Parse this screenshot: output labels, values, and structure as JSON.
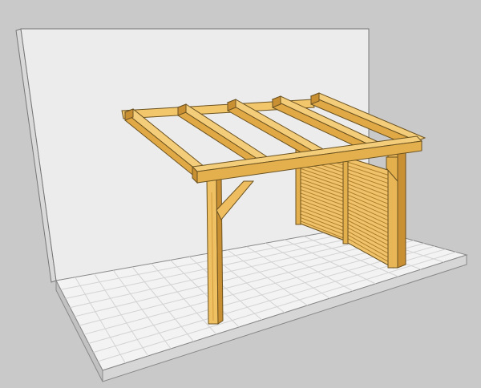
{
  "scene": {
    "subject": "wooden-pergola-lean-to",
    "colors": {
      "background": "#c9c9c9",
      "wall_front": "#ececec",
      "wall_side": "#dedede",
      "deck_top": "#f2f2f2",
      "deck_front": "#d8d8d8",
      "deck_side": "#c4c4c4",
      "wood_light": "#f2c66b",
      "wood_mid": "#e4b04e",
      "wood_dark": "#c98f33",
      "outline": "#6b5220"
    }
  }
}
